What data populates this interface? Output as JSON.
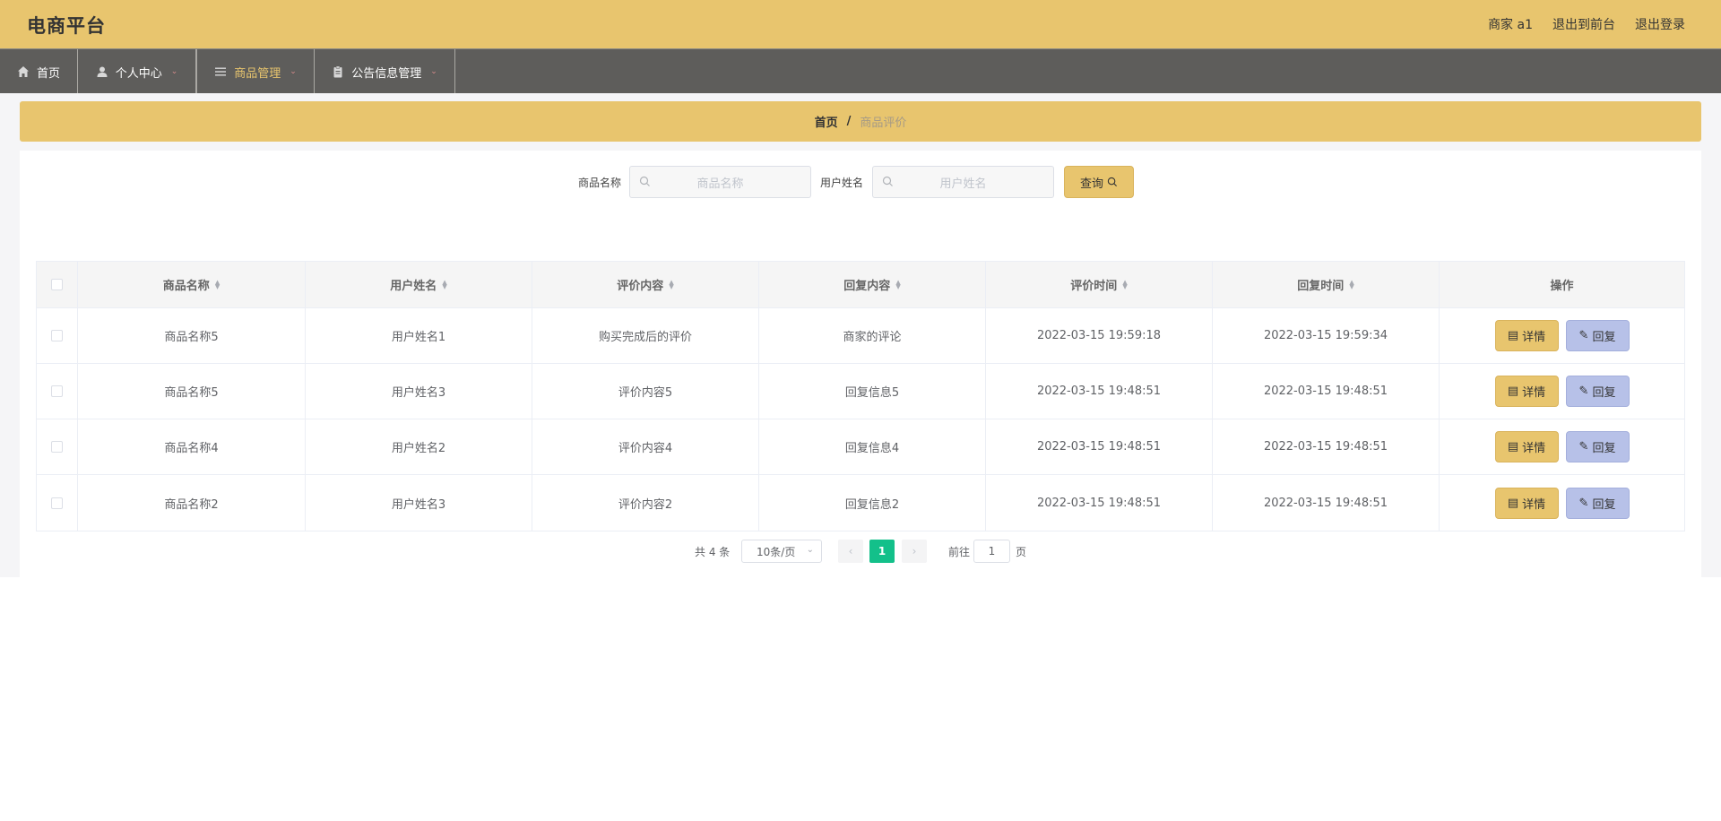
{
  "header": {
    "title": "电商平台",
    "links": [
      "商家 a1",
      "退出到前台",
      "退出登录"
    ]
  },
  "nav": {
    "items": [
      {
        "label": "首页",
        "icon": "home-icon",
        "dropdown": false
      },
      {
        "label": "个人中心",
        "icon": "user-icon",
        "dropdown": true
      },
      {
        "label": "商品管理",
        "icon": "menu-icon",
        "dropdown": true,
        "active": true
      },
      {
        "label": "公告信息管理",
        "icon": "clipboard-icon",
        "dropdown": true
      }
    ]
  },
  "breadcrumb": {
    "home": "首页",
    "separator": "/",
    "current": "商品评价"
  },
  "search": {
    "product_label": "商品名称",
    "product_placeholder": "商品名称",
    "user_label": "用户姓名",
    "user_placeholder": "用户姓名",
    "query_label": "查询"
  },
  "table": {
    "columns": [
      "商品名称",
      "用户姓名",
      "评价内容",
      "回复内容",
      "评价时间",
      "回复时间",
      "操作"
    ],
    "rows": [
      {
        "product": "商品名称5",
        "user": "用户姓名1",
        "review": "购买完成后的评价",
        "reply": "商家的评论",
        "review_time": "2022-03-15 19:59:18",
        "reply_time": "2022-03-15 19:59:34"
      },
      {
        "product": "商品名称5",
        "user": "用户姓名3",
        "review": "评价内容5",
        "reply": "回复信息5",
        "review_time": "2022-03-15 19:48:51",
        "reply_time": "2022-03-15 19:48:51"
      },
      {
        "product": "商品名称4",
        "user": "用户姓名2",
        "review": "评价内容4",
        "reply": "回复信息4",
        "review_time": "2022-03-15 19:48:51",
        "reply_time": "2022-03-15 19:48:51"
      },
      {
        "product": "商品名称2",
        "user": "用户姓名3",
        "review": "评价内容2",
        "reply": "回复信息2",
        "review_time": "2022-03-15 19:48:51",
        "reply_time": "2022-03-15 19:48:51"
      }
    ],
    "detail_label": "详情",
    "reply_label": "回复"
  },
  "pagination": {
    "total_text": "共 4 条",
    "page_size": "10条/页",
    "current_page": "1",
    "goto_label": "前往",
    "goto_value": "1",
    "page_suffix": "页"
  },
  "colors": {
    "accent": "#e8c56e",
    "nav_bg": "#5e5d5b",
    "page_active": "#13c08a",
    "reply_btn": "#b7c1e8"
  }
}
